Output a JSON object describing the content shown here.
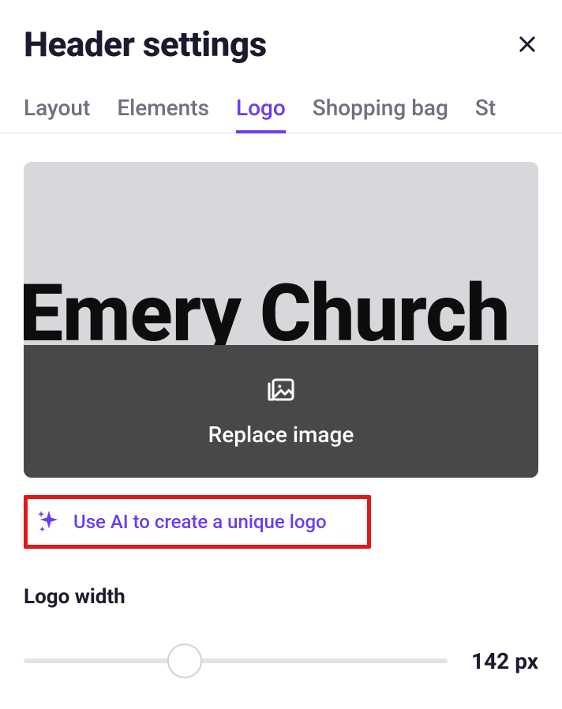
{
  "title": "Header settings",
  "tabs": [
    {
      "label": "Layout",
      "active": false
    },
    {
      "label": "Elements",
      "active": false
    },
    {
      "label": "Logo",
      "active": true
    },
    {
      "label": "Shopping bag",
      "active": false
    },
    {
      "label": "St",
      "active": false
    }
  ],
  "logo": {
    "preview_text": "Emery Church",
    "replace_label": "Replace image"
  },
  "ai": {
    "label": "Use AI to create a unique logo"
  },
  "width_field": {
    "label": "Logo width",
    "value_text": "142 px",
    "thumb_percent": 38
  },
  "highlight_color": "#e11818",
  "accent_color": "#6a3cf5"
}
